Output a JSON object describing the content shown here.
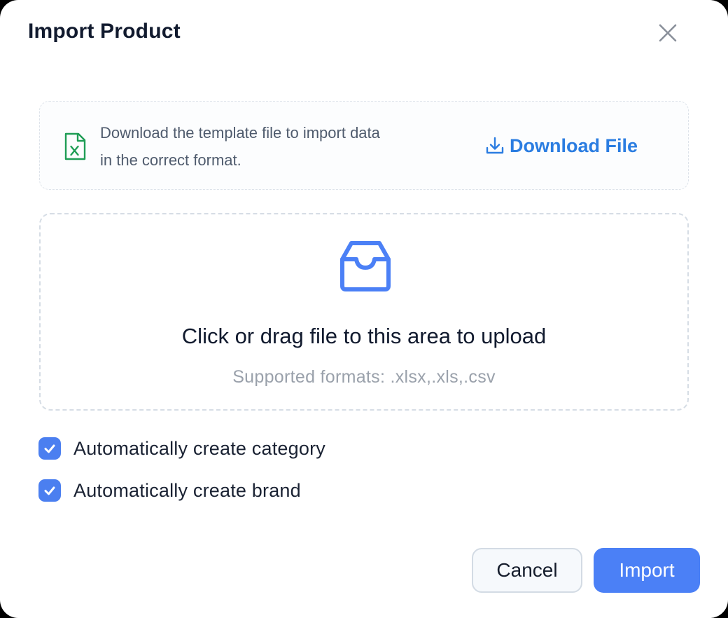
{
  "dialog": {
    "title": "Import Product",
    "close_icon": "close-icon"
  },
  "template": {
    "icon": "excel-file-icon",
    "line1": "Download the template file to import data",
    "line2": "in the correct format.",
    "download_icon": "download-icon",
    "download_label": "Download File"
  },
  "upload": {
    "icon": "inbox-icon",
    "title": "Click or drag file to this area to upload",
    "hint": "Supported formats: .xlsx,.xls,.csv"
  },
  "options": [
    {
      "label": "Automatically create category",
      "checked": true
    },
    {
      "label": "Automatically create brand",
      "checked": true
    }
  ],
  "footer": {
    "cancel_label": "Cancel",
    "import_label": "Import"
  },
  "colors": {
    "primary": "#4b80f6",
    "link": "#2b7de1",
    "excel_green": "#1f9d55",
    "title_text": "#111a2e"
  }
}
